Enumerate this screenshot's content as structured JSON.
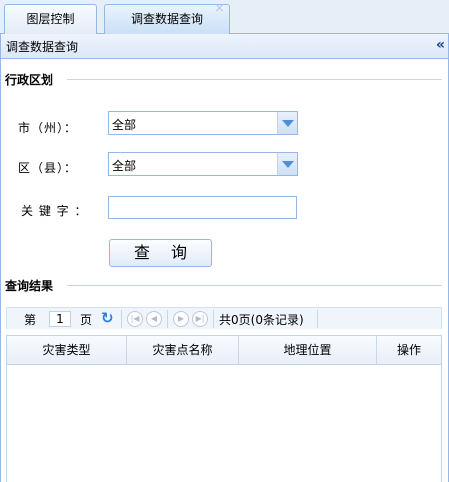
{
  "tabs": [
    {
      "label": "图层控制"
    },
    {
      "label": "调查数据查询"
    }
  ],
  "panel": {
    "title": "调查数据查询",
    "collapse_glyph": "«"
  },
  "admin_section": {
    "title": "行政区划",
    "city_label": "市（州）：",
    "city_value": "全部",
    "county_label": "区（县）：",
    "county_value": "全部",
    "keyword_label": "关 键 字 ：",
    "keyword_value": "",
    "query_button": "查 询"
  },
  "results_section": {
    "title": "查询结果",
    "pager": {
      "page_prefix": "第",
      "page_number": "1",
      "page_suffix": "页",
      "summary": "共0页(0条记录)"
    },
    "columns": [
      "灾害类型",
      "灾害点名称",
      "地理位置",
      "操作"
    ]
  },
  "colors": {
    "border": "#95b8e7",
    "accent": "#4e8fd8",
    "header_bg": "#dce8f7"
  }
}
